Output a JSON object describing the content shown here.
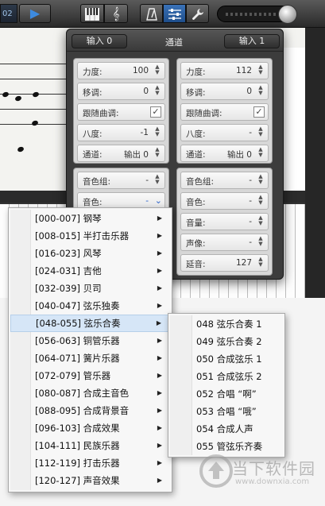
{
  "toolbar": {
    "counter": "02",
    "play_icon": "play-icon",
    "buttons": [
      "piano-keyboard-icon",
      "score-icon",
      "metronome-icon",
      "mixer-icon",
      "wrench-icon"
    ],
    "active_button": "mixer-icon",
    "volume_level": 0.95
  },
  "mixer": {
    "tabs": [
      "输入 0",
      "输入 1"
    ],
    "title": "通道",
    "columns": [
      {
        "rows": [
          {
            "label": "力度:",
            "value": "100"
          },
          {
            "label": "移调:",
            "value": "0"
          },
          {
            "label": "跟随曲调:",
            "checked": true
          },
          {
            "label": "八度:",
            "value": "-1"
          },
          {
            "label": "通道:",
            "value": "输出 0"
          }
        ],
        "sound_rows": [
          {
            "label": "音色组:",
            "value": "-"
          },
          {
            "label": "音色:",
            "value": "-"
          }
        ]
      },
      {
        "rows": [
          {
            "label": "力度:",
            "value": "112"
          },
          {
            "label": "移调:",
            "value": "0"
          },
          {
            "label": "跟随曲调:",
            "checked": true
          },
          {
            "label": "八度:",
            "value": "-"
          },
          {
            "label": "通道:",
            "value": "输出 0"
          }
        ],
        "sound_rows": [
          {
            "label": "音色组:",
            "value": "-"
          },
          {
            "label": "音色:",
            "value": "-"
          },
          {
            "label": "音量:",
            "value": "-"
          },
          {
            "label": "声像:",
            "value": "-"
          },
          {
            "label": "延音:",
            "value": "127"
          }
        ]
      }
    ]
  },
  "category_menu": {
    "items": [
      "[000-007] 钢琴",
      "[008-015] 半打击乐器",
      "[016-023] 风琴",
      "[024-031] 吉他",
      "[032-039] 贝司",
      "[040-047] 弦乐独奏",
      "[048-055] 弦乐合奏",
      "[056-063] 铜管乐器",
      "[064-071] 簧片乐器",
      "[072-079] 管乐器",
      "[080-087] 合成主音色",
      "[088-095] 合成背景音",
      "[096-103] 合成效果",
      "[104-111] 民族乐器",
      "[112-119] 打击乐器",
      "[120-127] 声音效果"
    ],
    "hover_index": 6
  },
  "submenu": {
    "items": [
      "048 弦乐合奏 1",
      "049 弦乐合奏 2",
      "050 合成弦乐 1",
      "051 合成弦乐 2",
      "052 合唱 “啊”",
      "053 合唱 “哦”",
      "054 合成人声",
      "055 管弦乐齐奏"
    ]
  },
  "watermark": {
    "title": "当下软件园",
    "url": "www.downxia.com"
  }
}
